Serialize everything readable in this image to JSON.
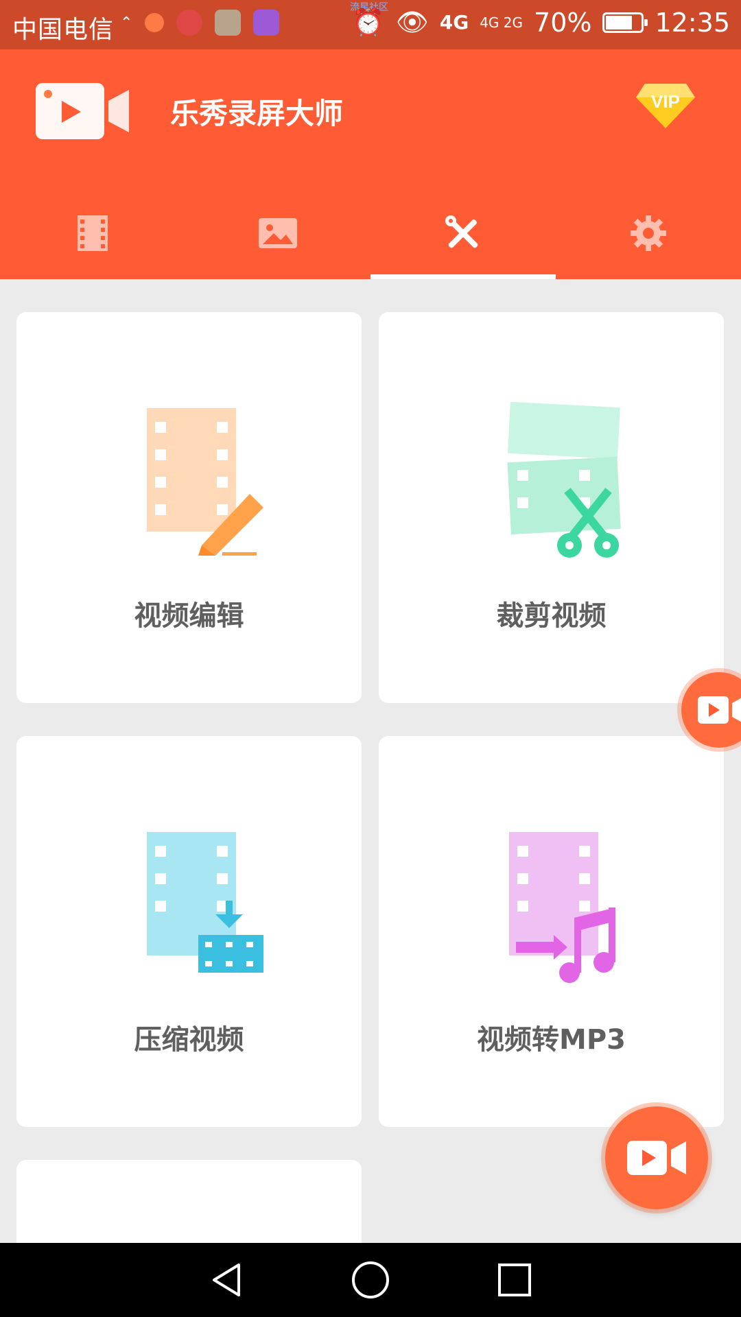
{
  "status_bar": {
    "carrier": "中国电信",
    "watermark": "流星社区",
    "network": "4G",
    "network2": "4G 2G",
    "battery": "70%",
    "time": "12:35"
  },
  "header": {
    "app_title": "乐秀录屏大师",
    "vip_label": "VIP"
  },
  "tabs": [
    {
      "icon": "film-icon",
      "active": false
    },
    {
      "icon": "image-icon",
      "active": false
    },
    {
      "icon": "tools-icon",
      "active": true
    },
    {
      "icon": "gear-icon",
      "active": false
    }
  ],
  "cards": [
    {
      "label": "视频编辑",
      "icon": "video-edit-icon",
      "color": "#ffc9a0"
    },
    {
      "label": "裁剪视频",
      "icon": "video-trim-icon",
      "color": "#5de0b0"
    },
    {
      "label": "压缩视频",
      "icon": "video-compress-icon",
      "color": "#4fc9e6"
    },
    {
      "label": "视频转MP3",
      "icon": "video-to-mp3-icon",
      "color": "#e67ae6"
    }
  ],
  "colors": {
    "header": "#ff5c36",
    "statusbar": "#cc4a29",
    "background": "#ebebeb"
  }
}
